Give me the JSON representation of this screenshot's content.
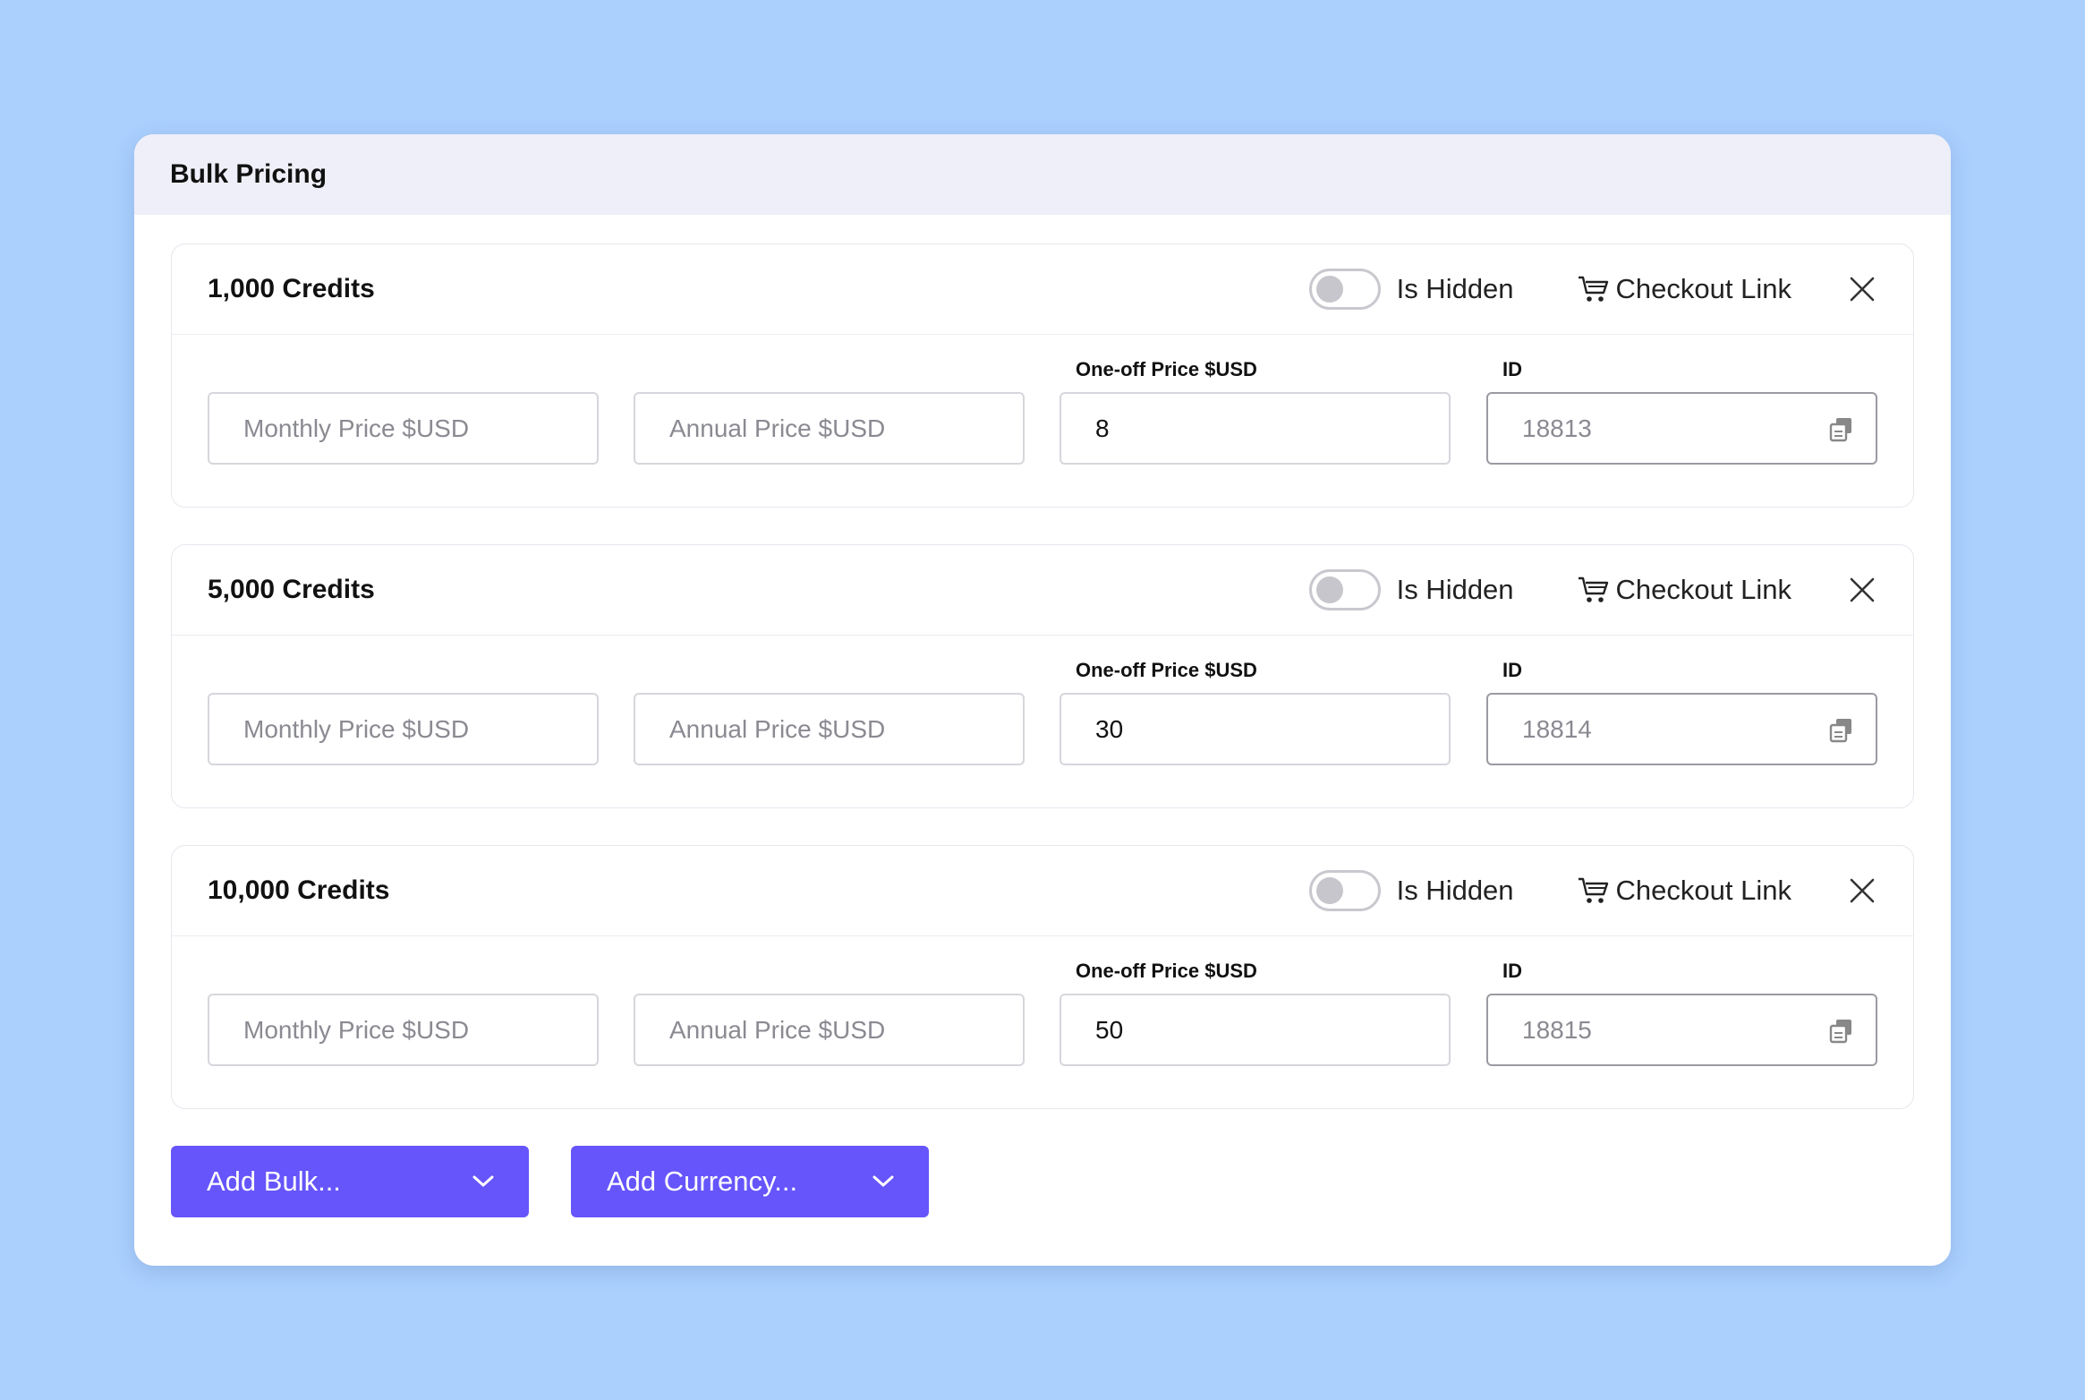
{
  "panel": {
    "title": "Bulk Pricing"
  },
  "items": [
    {
      "title": "1,000 Credits",
      "is_hidden_label": "Is Hidden",
      "checkout_label": "Checkout Link",
      "monthly_placeholder": "Monthly Price $USD",
      "annual_placeholder": "Annual Price $USD",
      "oneoff_label": "One-off Price $USD",
      "oneoff_value": "8",
      "id_label": "ID",
      "id_value": "18813"
    },
    {
      "title": "5,000 Credits",
      "is_hidden_label": "Is Hidden",
      "checkout_label": "Checkout Link",
      "monthly_placeholder": "Monthly Price $USD",
      "annual_placeholder": "Annual Price $USD",
      "oneoff_label": "One-off Price $USD",
      "oneoff_value": "30",
      "id_label": "ID",
      "id_value": "18814"
    },
    {
      "title": "10,000 Credits",
      "is_hidden_label": "Is Hidden",
      "checkout_label": "Checkout Link",
      "monthly_placeholder": "Monthly Price $USD",
      "annual_placeholder": "Annual Price $USD",
      "oneoff_label": "One-off Price $USD",
      "oneoff_value": "50",
      "id_label": "ID",
      "id_value": "18815"
    }
  ],
  "actions": {
    "add_bulk_label": "Add Bulk...",
    "add_currency_label": "Add Currency..."
  },
  "icons": {
    "cart": "cart-icon",
    "close": "close-icon",
    "copy": "copy-icon",
    "chevron": "chevron-down-icon"
  },
  "colors": {
    "background": "#abd0fe",
    "accent": "#6655fb",
    "header": "#efeff9"
  }
}
